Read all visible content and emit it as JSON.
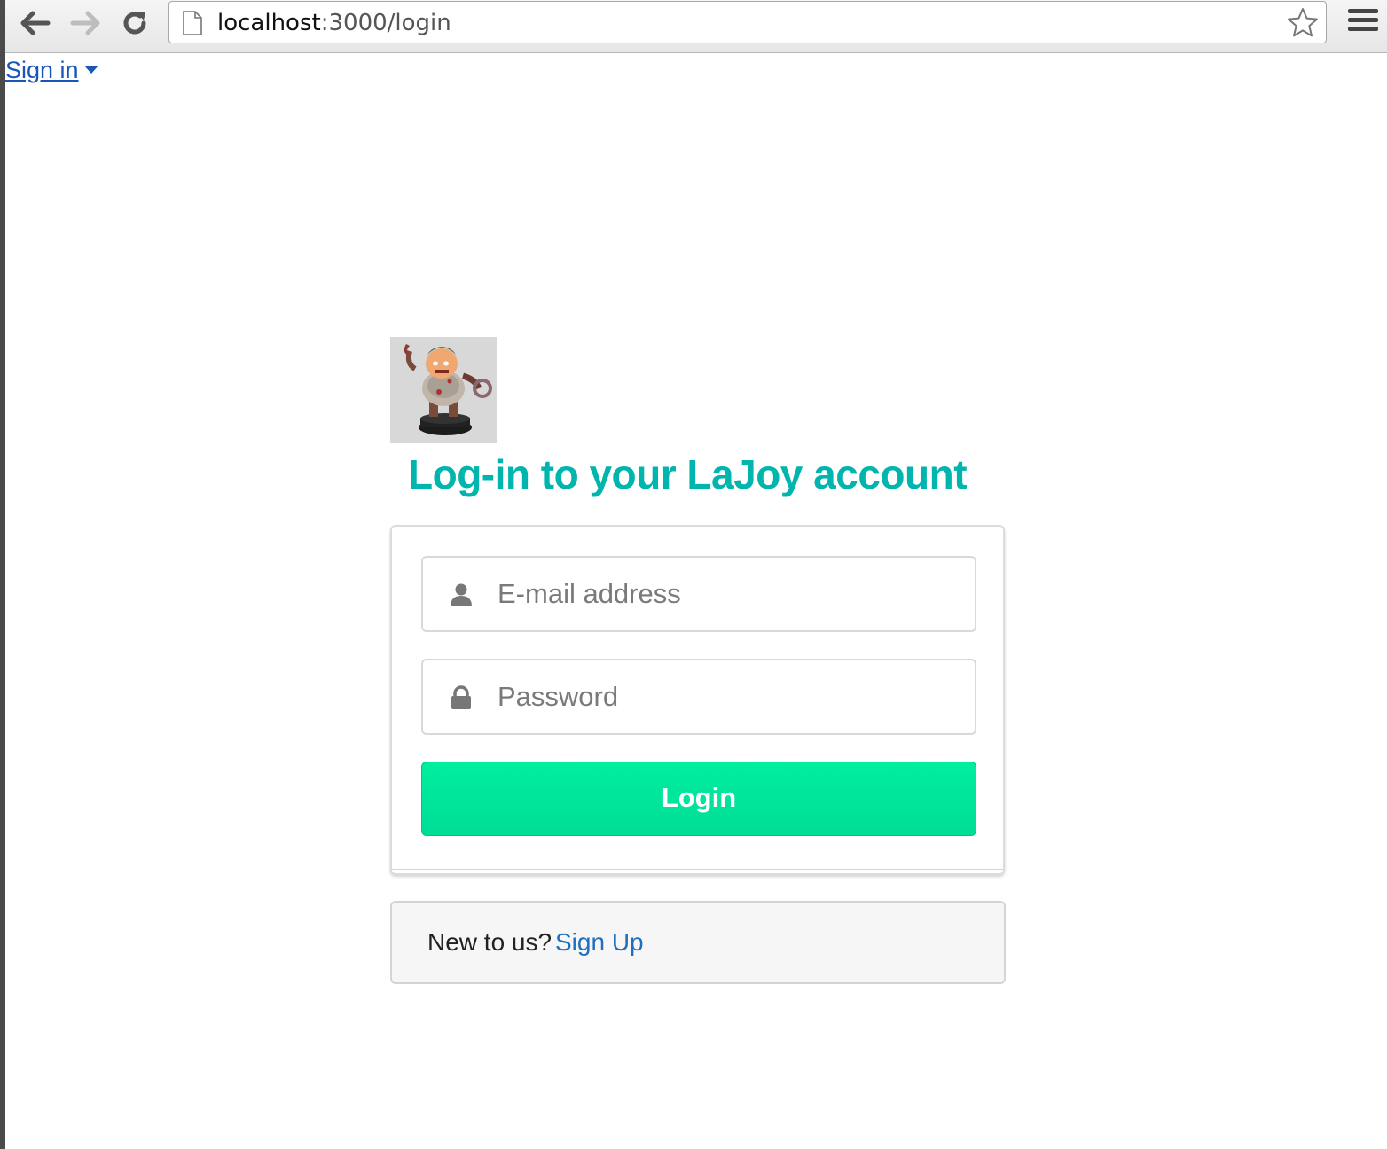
{
  "browser": {
    "url_host": "localhost",
    "url_path": ":3000/login",
    "icons": {
      "back": "arrow-left-icon",
      "forward": "arrow-right-icon",
      "reload": "reload-icon",
      "page": "page-icon",
      "bookmark": "star-icon",
      "menu": "hamburger-menu-icon"
    }
  },
  "nav": {
    "signin_label": "Sign in"
  },
  "login": {
    "heading": "Log-in to your LaJoy account",
    "email_placeholder": "E-mail address",
    "password_placeholder": "Password",
    "login_button": "Login",
    "email_icon": "user-icon",
    "password_icon": "lock-icon"
  },
  "signup": {
    "prompt": "New to us?",
    "link": "Sign Up"
  },
  "colors": {
    "heading": "#00b5ad",
    "login_button": "#00e699",
    "link": "#1e70bf"
  }
}
